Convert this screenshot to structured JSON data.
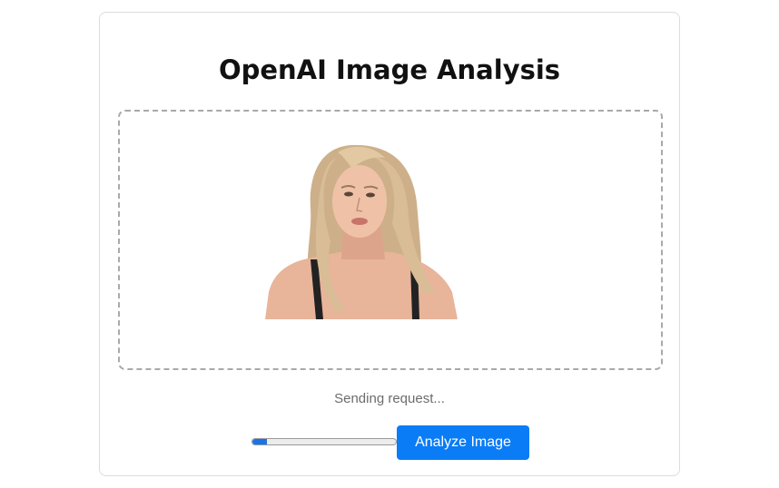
{
  "page": {
    "title": "OpenAI Image Analysis"
  },
  "upload": {
    "has_image": true,
    "image_subject": "portrait of a woman with long blonde hair"
  },
  "status": {
    "text": "Sending request..."
  },
  "progress": {
    "value": 0.1
  },
  "actions": {
    "analyze_label": "Analyze Image"
  },
  "colors": {
    "accent": "#0a7cf6",
    "progress_fill": "#1a73e8",
    "status_text": "#6c6c6c",
    "dropzone_border": "#a9a9a9"
  }
}
